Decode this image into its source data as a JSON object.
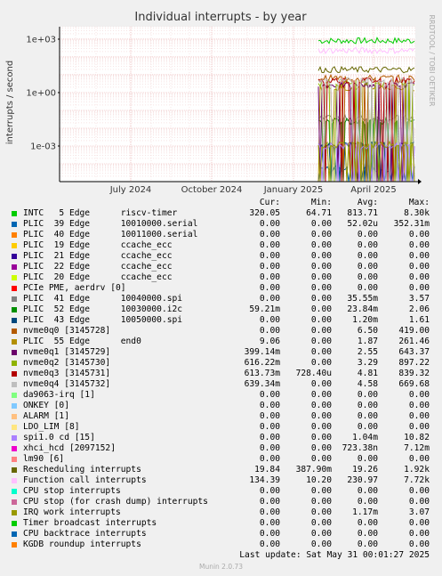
{
  "chart_data": {
    "type": "line",
    "title": "Individual interrupts - by year",
    "ylabel": "interrupts / second",
    "yscale": "log",
    "ylim": [
      1e-05,
      5000
    ],
    "y_ticks": [
      {
        "value": 0.001,
        "label": "1e-03"
      },
      {
        "value": 1,
        "label": "1e+00"
      },
      {
        "value": 1000,
        "label": "1e+03"
      }
    ],
    "x_ticks": [
      "July 2024",
      "October 2024",
      "January 2025",
      "April 2025"
    ],
    "grid": true,
    "side_text": "RRDTOOL / TOBI OETIKER",
    "columns": [
      "Cur:",
      "Min:",
      "Avg:",
      "Max:"
    ],
    "series": [
      {
        "name": "INTC   5 Edge      riscv-timer",
        "color": "#00cc00",
        "cur": "320.05",
        "min": "64.71",
        "avg": "813.71",
        "max": "8.30k"
      },
      {
        "name": "PLIC  39 Edge      10010000.serial",
        "color": "#0066b3",
        "cur": "0.00",
        "min": "0.00",
        "avg": "52.02u",
        "max": "352.31m"
      },
      {
        "name": "PLIC  40 Edge      10011000.serial",
        "color": "#ff8000",
        "cur": "0.00",
        "min": "0.00",
        "avg": "0.00",
        "max": "0.00"
      },
      {
        "name": "PLIC  19 Edge      ccache_ecc",
        "color": "#ffcc00",
        "cur": "0.00",
        "min": "0.00",
        "avg": "0.00",
        "max": "0.00"
      },
      {
        "name": "PLIC  21 Edge      ccache_ecc",
        "color": "#330099",
        "cur": "0.00",
        "min": "0.00",
        "avg": "0.00",
        "max": "0.00"
      },
      {
        "name": "PLIC  22 Edge      ccache_ecc",
        "color": "#990099",
        "cur": "0.00",
        "min": "0.00",
        "avg": "0.00",
        "max": "0.00"
      },
      {
        "name": "PLIC  20 Edge      ccache_ecc",
        "color": "#ccff00",
        "cur": "0.00",
        "min": "0.00",
        "avg": "0.00",
        "max": "0.00"
      },
      {
        "name": "PCIe PME, aerdrv [0]",
        "color": "#ff0000",
        "cur": "0.00",
        "min": "0.00",
        "avg": "0.00",
        "max": "0.00"
      },
      {
        "name": "PLIC  41 Edge      10040000.spi",
        "color": "#808080",
        "cur": "0.00",
        "min": "0.00",
        "avg": "35.55m",
        "max": "3.57"
      },
      {
        "name": "PLIC  52 Edge      10030000.i2c",
        "color": "#008f00",
        "cur": "59.21m",
        "min": "0.00",
        "avg": "23.84m",
        "max": "2.06"
      },
      {
        "name": "PLIC  43 Edge      10050000.spi",
        "color": "#00487d",
        "cur": "0.00",
        "min": "0.00",
        "avg": "1.20m",
        "max": "1.61"
      },
      {
        "name": "nvme0q0 [3145728]",
        "color": "#b35a00",
        "cur": "0.00",
        "min": "0.00",
        "avg": "6.50",
        "max": "419.00"
      },
      {
        "name": "PLIC  55 Edge      end0",
        "color": "#b38f00",
        "cur": "9.06",
        "min": "0.00",
        "avg": "1.87",
        "max": "261.46"
      },
      {
        "name": "nvme0q1 [3145729]",
        "color": "#6b006b",
        "cur": "399.14m",
        "min": "0.00",
        "avg": "2.55",
        "max": "643.37"
      },
      {
        "name": "nvme0q2 [3145730]",
        "color": "#8fb300",
        "cur": "616.22m",
        "min": "0.00",
        "avg": "3.29",
        "max": "897.22"
      },
      {
        "name": "nvme0q3 [3145731]",
        "color": "#b30000",
        "cur": "613.73m",
        "min": "728.40u",
        "avg": "4.81",
        "max": "839.32"
      },
      {
        "name": "nvme0q4 [3145732]",
        "color": "#bebebe",
        "cur": "639.34m",
        "min": "0.00",
        "avg": "4.58",
        "max": "669.68"
      },
      {
        "name": "da9063-irq [1]",
        "color": "#80ff80",
        "cur": "0.00",
        "min": "0.00",
        "avg": "0.00",
        "max": "0.00"
      },
      {
        "name": "ONKEY [0]",
        "color": "#80c9ff",
        "cur": "0.00",
        "min": "0.00",
        "avg": "0.00",
        "max": "0.00"
      },
      {
        "name": "ALARM [1]",
        "color": "#ffc080",
        "cur": "0.00",
        "min": "0.00",
        "avg": "0.00",
        "max": "0.00"
      },
      {
        "name": "LDO_LIM [8]",
        "color": "#ffe680",
        "cur": "0.00",
        "min": "0.00",
        "avg": "0.00",
        "max": "0.00"
      },
      {
        "name": "spi1.0 cd [15]",
        "color": "#aa80ff",
        "cur": "0.00",
        "min": "0.00",
        "avg": "1.04m",
        "max": "10.82"
      },
      {
        "name": "xhci_hcd [2097152]",
        "color": "#ee00cc",
        "cur": "0.00",
        "min": "0.00",
        "avg": "723.38n",
        "max": "7.12m"
      },
      {
        "name": "lm90 [6]",
        "color": "#ff8080",
        "cur": "0.00",
        "min": "0.00",
        "avg": "0.00",
        "max": "0.00"
      },
      {
        "name": "Rescheduling interrupts",
        "color": "#666600",
        "cur": "19.84",
        "min": "387.90m",
        "avg": "19.26",
        "max": "1.92k"
      },
      {
        "name": "Function call interrupts",
        "color": "#ffbfff",
        "cur": "134.39",
        "min": "10.20",
        "avg": "230.97",
        "max": "7.72k"
      },
      {
        "name": "CPU stop interrupts",
        "color": "#00ffcc",
        "cur": "0.00",
        "min": "0.00",
        "avg": "0.00",
        "max": "0.00"
      },
      {
        "name": "CPU stop (for crash dump) interrupts",
        "color": "#cc6699",
        "cur": "0.00",
        "min": "0.00",
        "avg": "0.00",
        "max": "0.00"
      },
      {
        "name": "IRQ work interrupts",
        "color": "#999900",
        "cur": "0.00",
        "min": "0.00",
        "avg": "1.17m",
        "max": "3.07"
      },
      {
        "name": "Timer broadcast interrupts",
        "color": "#00cc00",
        "cur": "0.00",
        "min": "0.00",
        "avg": "0.00",
        "max": "0.00"
      },
      {
        "name": "CPU backtrace interrupts",
        "color": "#0066b3",
        "cur": "0.00",
        "min": "0.00",
        "avg": "0.00",
        "max": "0.00"
      },
      {
        "name": "KGDB roundup interrupts",
        "color": "#ff8000",
        "cur": "0.00",
        "min": "0.00",
        "avg": "0.00",
        "max": "0.00"
      }
    ]
  },
  "footer": {
    "last_update": "Last update: Sat May 31 00:01:27 2025",
    "munin": "Munin 2.0.73"
  }
}
